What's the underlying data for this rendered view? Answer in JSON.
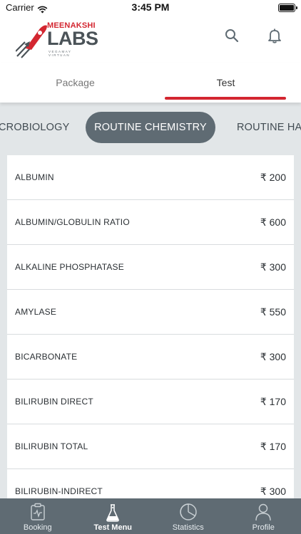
{
  "status_bar": {
    "carrier": "Carrier",
    "time": "3:45 PM",
    "wifi_icon": "wifi-icon",
    "battery_icon": "battery-icon"
  },
  "header": {
    "logo": {
      "top_text": "MEENAKSHI",
      "main_text": "LABS",
      "sub_text": "VEGAMAY VIRTUAN"
    },
    "search_icon": "search-icon",
    "bell_icon": "bell-icon"
  },
  "tabs": [
    {
      "label": "Package",
      "selected": false
    },
    {
      "label": "Test",
      "selected": true
    }
  ],
  "categories": [
    {
      "label": "CROBIOLOGY",
      "selected": false
    },
    {
      "label": "ROUTINE CHEMISTRY",
      "selected": true
    },
    {
      "label": "ROUTINE HAE",
      "selected": false
    }
  ],
  "tests": [
    {
      "name": "ALBUMIN",
      "price": "₹ 200"
    },
    {
      "name": "ALBUMIN/GLOBULIN RATIO",
      "price": "₹ 600"
    },
    {
      "name": "ALKALINE PHOSPHATASE",
      "price": "₹ 300"
    },
    {
      "name": "AMYLASE",
      "price": "₹ 550"
    },
    {
      "name": "BICARBONATE",
      "price": "₹ 300"
    },
    {
      "name": "BILIRUBIN DIRECT",
      "price": "₹ 170"
    },
    {
      "name": "BILIRUBIN TOTAL",
      "price": "₹ 170"
    },
    {
      "name": "BILIRUBIN-INDIRECT",
      "price": "₹ 300"
    }
  ],
  "bottom_nav": [
    {
      "label": "Booking",
      "icon": "clipboard-icon",
      "active": false
    },
    {
      "label": "Test Menu",
      "icon": "flask-icon",
      "active": true
    },
    {
      "label": "Statistics",
      "icon": "pie-chart-icon",
      "active": false
    },
    {
      "label": "Profile",
      "icon": "user-icon",
      "active": false
    }
  ],
  "colors": {
    "accent": "#d32630",
    "chip": "#5f6b73",
    "strip": "#e2e6e8",
    "nav": "#5f6b73"
  }
}
